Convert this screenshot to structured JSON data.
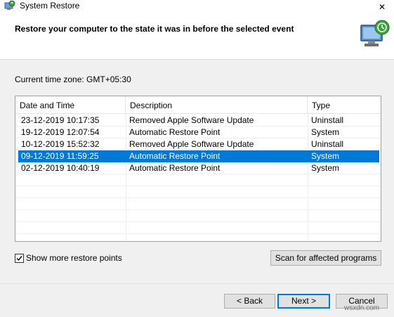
{
  "window": {
    "title": "System Restore",
    "close_symbol": "✕"
  },
  "header": {
    "heading": "Restore your computer to the state it was in before the selected event"
  },
  "timezone": {
    "label": "Current time zone: GMT+05:30"
  },
  "table": {
    "columns": [
      "Date and Time",
      "Description",
      "Type"
    ],
    "rows": [
      {
        "date": "23-12-2019 10:17:35",
        "description": "Removed Apple Software Update",
        "type": "Uninstall"
      },
      {
        "date": "19-12-2019 12:07:54",
        "description": "Automatic Restore Point",
        "type": "System"
      },
      {
        "date": "10-12-2019 15:52:32",
        "description": "Removed Apple Software Update",
        "type": "Uninstall"
      },
      {
        "date": "09-12-2019 11:59:25",
        "description": "Automatic Restore Point",
        "type": "System"
      },
      {
        "date": "02-12-2019 10:40:19",
        "description": "Automatic Restore Point",
        "type": "System"
      }
    ],
    "selected_index": 3
  },
  "options": {
    "show_more_label": "Show more restore points",
    "show_more_checked": true
  },
  "buttons": {
    "scan": "Scan for affected programs",
    "back": "< Back",
    "next": "Next >",
    "cancel": "Cancel"
  },
  "watermark": "wsxdn.com",
  "colors": {
    "selection": "#0078d7",
    "default_button_border": "#0078d7"
  }
}
